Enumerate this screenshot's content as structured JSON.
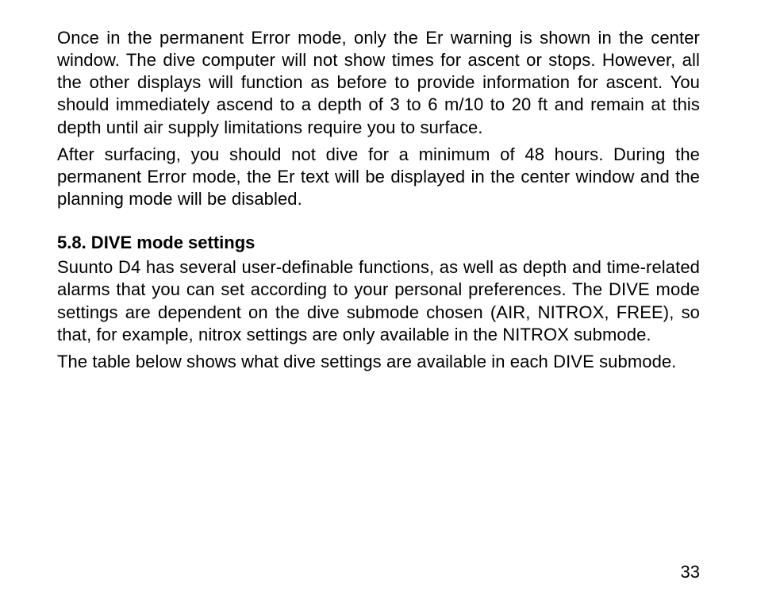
{
  "body": {
    "p1": "Once in the permanent Error mode, only the Er warning is shown in the center window. The dive computer will not show times for ascent or stops. However, all the other displays will function as before to provide information for ascent. You should immediately ascend to a depth of 3 to 6 m/10 to 20 ft and remain at this depth until air supply limitations require you to surface.",
    "p2": "After surfacing, you should not dive for a minimum of 48 hours. During the permanent Error mode, the Er text will be displayed in the center window and the planning mode will be disabled.",
    "heading": "5.8. DIVE mode settings",
    "p3": "Suunto D4 has several user-definable functions, as well as depth and time-related alarms that you can set according to your personal preferences. The DIVE mode settings are dependent on the dive submode chosen (AIR, NITROX, FREE), so that, for example, nitrox settings are only available in the NITROX submode.",
    "p4": "The table below shows what dive settings are available in each DIVE submode."
  },
  "page_number": "33"
}
